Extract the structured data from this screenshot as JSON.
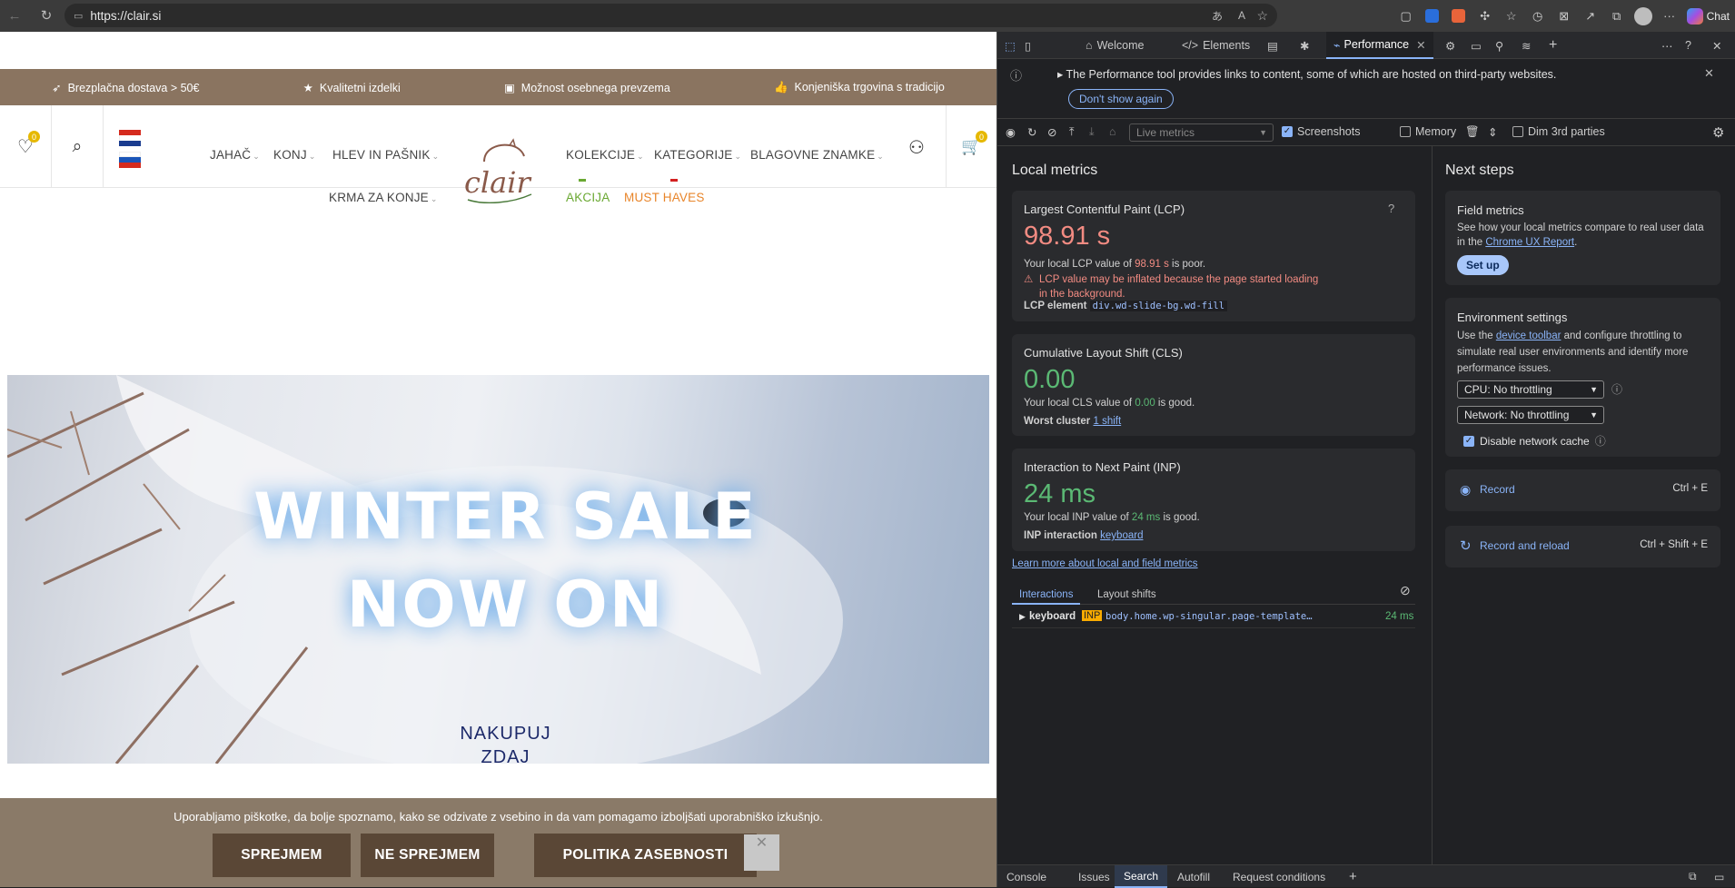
{
  "browser": {
    "url": "https://clair.si",
    "chat_label": "Chat"
  },
  "site": {
    "promo": [
      "Brezplačna dostava > 50€",
      "Kvalitetni izdelki",
      "Možnost osebnega prevzema",
      "Konjeniška trgovina s tradicijo"
    ],
    "wishlist_count": "0",
    "cart_count": "0",
    "nav": {
      "jahac": "JAHAČ",
      "konj": "KONJ",
      "hlev": "HLEV IN PAŠNIK",
      "krma": "KRMA ZA KONJE",
      "kolekcije": "KOLEKCIJE",
      "kategorije": "KATEGORIJE",
      "znamke": "BLAGOVNE ZNAMKE",
      "akcija": "AKCIJA",
      "must": "MUST HAVES"
    },
    "logo": "clair",
    "hero": {
      "line1": "WINTER SALE",
      "line2": "NOW ON",
      "cta1": "NAKUPUJ",
      "cta2": "ZDAJ"
    },
    "cookie": {
      "text": "Uporabljamo piškotke, da bolje spoznamo, kako se odzivate z vsebino in da vam pomagamo izboljšati uporabniško izkušnjo.",
      "accept": "SPREJMEM",
      "reject": "NE SPREJMEM",
      "policy": "POLITIKA ZASEBNOSTI"
    }
  },
  "devtools": {
    "tabs": {
      "welcome": "Welcome",
      "elements": "Elements",
      "performance": "Performance"
    },
    "info": "The Performance tool provides links to content, some of which are hosted on third-party websites.",
    "dont_show": "Don't show again",
    "toolbar": {
      "live": "Live metrics",
      "screenshots": "Screenshots",
      "memory": "Memory",
      "dim": "Dim 3rd parties"
    },
    "local_title": "Local metrics",
    "lcp": {
      "title": "Largest Contentful Paint (LCP)",
      "value": "98.91 s",
      "desc_a": "Your local LCP value of ",
      "desc_v": "98.91 s",
      "desc_b": " is poor.",
      "warn": "LCP value may be inflated because the page started loading in the background.",
      "el_label": "LCP element",
      "el_value": "div.wd-slide-bg.wd-fill"
    },
    "cls": {
      "title": "Cumulative Layout Shift (CLS)",
      "value": "0.00",
      "desc_a": "Your local CLS value of ",
      "desc_v": "0.00",
      "desc_b": " is good.",
      "wc_label": "Worst cluster",
      "wc_value": "1 shift"
    },
    "inp": {
      "title": "Interaction to Next Paint (INP)",
      "value": "24 ms",
      "desc_a": "Your local INP value of ",
      "desc_v": "24 ms",
      "desc_b": " is good.",
      "int_label": "INP interaction",
      "int_value": "keyboard"
    },
    "learn_more": "Learn more about local and field metrics",
    "sub_tabs": {
      "interactions": "Interactions",
      "layout": "Layout shifts"
    },
    "row": {
      "name": "keyboard",
      "tag": "INP",
      "selector": "body.home.wp-singular.page-template…",
      "time": "24 ms"
    },
    "next_title": "Next steps",
    "field": {
      "title": "Field metrics",
      "text1": "See how your local metrics compare to real user data in the ",
      "link": "Chrome UX Report",
      "text2": ".",
      "button": "Set up"
    },
    "env": {
      "title": "Environment settings",
      "t1": "Use the ",
      "link": "device toolbar",
      "t2": " and configure throttling to simulate real user environments and identify more performance issues.",
      "cpu": "CPU: No throttling",
      "network": "Network: No throttling",
      "cache": "Disable network cache"
    },
    "record": {
      "label": "Record",
      "shortcut": "Ctrl + E"
    },
    "reload": {
      "label": "Record and reload",
      "shortcut": "Ctrl + Shift + E"
    },
    "bottom_tabs": [
      "Console",
      "Issues",
      "Search",
      "Autofill",
      "Request conditions"
    ]
  },
  "colors": {
    "poor": "#f28b82",
    "good": "#5bb974",
    "accent": "#8ab4f8",
    "promo_bg": "#8a7460",
    "cookie_btn": "#5a4736"
  }
}
